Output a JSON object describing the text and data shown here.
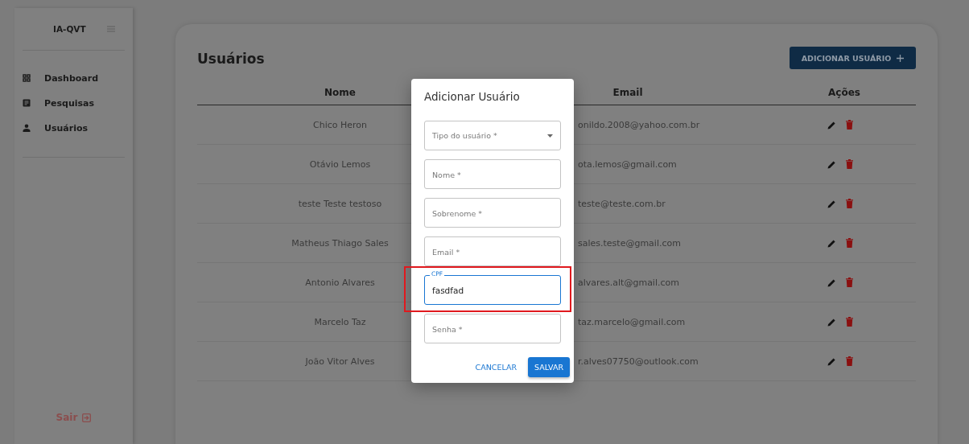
{
  "sidebar": {
    "brand": "IA-QVT",
    "items": [
      {
        "label": "Dashboard"
      },
      {
        "label": "Pesquisas"
      },
      {
        "label": "Usuários"
      }
    ],
    "logout": "Sair"
  },
  "page": {
    "title": "Usuários",
    "add_button": "ADICIONAR USUÁRIO",
    "table": {
      "columns": [
        "Nome",
        "Email",
        "Ações"
      ],
      "rows": [
        {
          "name": "Chico Heron",
          "email": "onildo.2008@yahoo.com.br"
        },
        {
          "name": "Otávio Lemos",
          "email": "ota.lemos@gmail.com"
        },
        {
          "name": "teste Teste testoso",
          "email": "teste@teste.com.br"
        },
        {
          "name": "Matheus Thiago Sales",
          "email": "sales.teste@gmail.com"
        },
        {
          "name": "Antonio Alvares",
          "email": "alvares.alt@gmail.com"
        },
        {
          "name": "Marcelo Taz",
          "email": "taz.marcelo@gmail.com"
        },
        {
          "name": "João Vitor Alves",
          "email": "r.alves07750@outlook.com"
        }
      ]
    }
  },
  "dialog": {
    "title": "Adicionar Usuário",
    "fields": [
      {
        "kind": "select",
        "placeholder": "Tipo do usuário *",
        "focused": false,
        "highlighted": false
      },
      {
        "kind": "text",
        "placeholder": "Nome *",
        "focused": false,
        "highlighted": false
      },
      {
        "kind": "text",
        "placeholder": "Sobrenome *",
        "focused": false,
        "highlighted": false
      },
      {
        "kind": "text",
        "placeholder": "Email *",
        "focused": false,
        "highlighted": false
      },
      {
        "kind": "text",
        "label": "CPF",
        "value": "fasdfad",
        "focused": true,
        "highlighted": true
      },
      {
        "kind": "text",
        "placeholder": "Senha *",
        "focused": false,
        "highlighted": false
      }
    ],
    "buttons": [
      {
        "label": "CANCELAR",
        "kind": "text"
      },
      {
        "label": "SALVAR",
        "kind": "contained"
      }
    ]
  }
}
